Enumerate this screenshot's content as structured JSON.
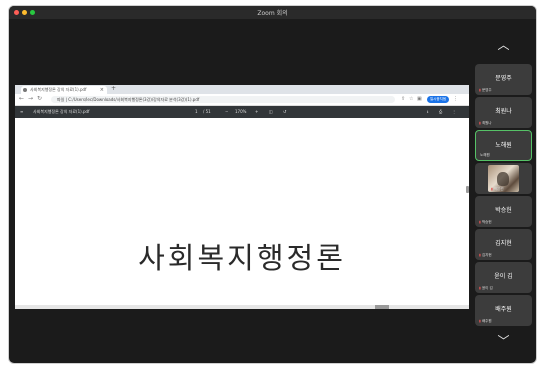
{
  "window": {
    "title": "Zoom 회의",
    "traffic_lights": [
      "#ff5f57",
      "#febc2e",
      "#28c840"
    ]
  },
  "browser": {
    "tab_title": "사회복지행정론 강의 자료(1).pdf",
    "tab_close": "×",
    "new_tab": "+",
    "url": "파일 | C:/Users/lec/Downloads/사회복지행정론(3강)/강의자료 분석(3강)(1).pdf",
    "profile_label": "일시중지됨"
  },
  "pdf": {
    "filename": "사회복지행정론 강의 자료(1).pdf",
    "page_current": "1",
    "page_total": "/ 51",
    "zoom": "170%",
    "document_title": "사회복지행정론"
  },
  "participants": [
    {
      "name": "문영주",
      "label": "문영주",
      "active": false,
      "video": false
    },
    {
      "name": "최원나",
      "label": "최원나",
      "active": false,
      "video": false
    },
    {
      "name": "노해원",
      "label": "노해원",
      "active": true,
      "video": false
    },
    {
      "name": "",
      "label": "박은선",
      "active": false,
      "video": true
    },
    {
      "name": "박승헌",
      "label": "박승헌",
      "active": false,
      "video": false
    },
    {
      "name": "김지현",
      "label": "김지현",
      "active": false,
      "video": false
    },
    {
      "name": "윤이 김",
      "label": "윤이 김",
      "active": false,
      "video": false
    },
    {
      "name": "배주원",
      "label": "배주원",
      "active": false,
      "video": false
    }
  ],
  "icons": {
    "scroll_up": "chevron-up-icon",
    "scroll_down": "chevron-down-icon",
    "mic_muted": "mic-muted-icon"
  }
}
